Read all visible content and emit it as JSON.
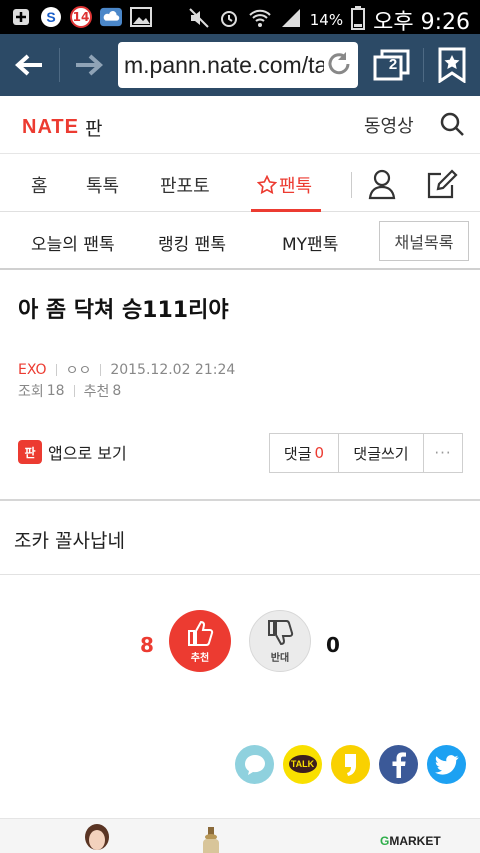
{
  "statusbar": {
    "badge_count": "14",
    "battery_pct": "14%",
    "time": "오후 9:26"
  },
  "browser": {
    "url": "m.pann.nate.com/tal",
    "tab_count": "2"
  },
  "header": {
    "logo_brand": "NATE",
    "logo_service": "판",
    "video_link": "동영상"
  },
  "main_nav": {
    "items": [
      {
        "label": "홈"
      },
      {
        "label": "톡톡"
      },
      {
        "label": "판포토"
      },
      {
        "label": "팬톡"
      }
    ],
    "active_index": 3
  },
  "sub_nav": {
    "items": [
      {
        "label": "오늘의 팬톡"
      },
      {
        "label": "랭킹 팬톡"
      },
      {
        "label": "MY팬톡"
      }
    ],
    "channel_list": "채널목록"
  },
  "article": {
    "title": "아 좀 닥쳐 승111리야",
    "channel": "EXO",
    "author": "ㅇㅇ",
    "datetime": "2015.12.02 21:24",
    "views_label": "조회",
    "views": "18",
    "recommend_label": "추천",
    "recommend": "8",
    "app_icon_text": "판",
    "app_view": "앱으로 보기",
    "comment_label": "댓글",
    "comment_count": "0",
    "write_comment": "댓글쓰기",
    "more": "···",
    "body": "조카 꼴사납네"
  },
  "vote": {
    "up_count": "8",
    "up_label": "추천",
    "down_count": "0",
    "down_label": "반대"
  },
  "share": {
    "talk_label": "TALK"
  },
  "ad": {
    "brand_g": "G",
    "brand_rest": "MARKET"
  },
  "colors": {
    "accent": "#ec3b31",
    "browser_bar": "#2c4a66",
    "kakao_yellow": "#f9e000",
    "facebook": "#3b5998",
    "twitter": "#1da1f2",
    "kakaostory_blue": "#8fd1de"
  }
}
